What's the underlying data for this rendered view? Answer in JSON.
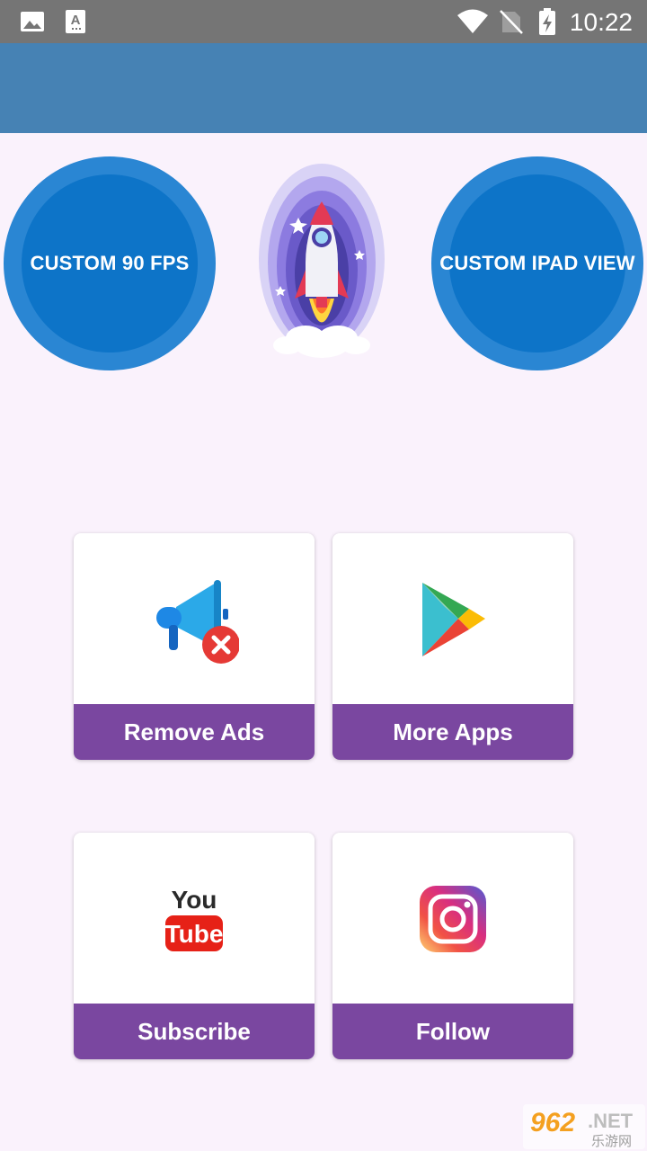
{
  "status_bar": {
    "time": "10:22",
    "icons": [
      "image-icon",
      "font-icon",
      "wifi-icon",
      "no-sim-icon",
      "battery-charging-icon"
    ]
  },
  "main": {
    "left_button": {
      "label": "CUSTOM 90 FPS"
    },
    "right_button": {
      "label": "CUSTOM IPAD VIEW"
    },
    "center_image": "rocket-icon"
  },
  "cards": [
    {
      "label": "Remove Ads",
      "icon": "remove-ads-megaphone-icon"
    },
    {
      "label": "More Apps",
      "icon": "google-play-icon"
    },
    {
      "label": "Subscribe",
      "icon": "youtube-icon"
    },
    {
      "label": "Follow",
      "icon": "instagram-icon"
    }
  ],
  "watermark": {
    "brand": "962",
    "domain": ".NET",
    "sub": "乐游网"
  },
  "colors": {
    "app_bar": "#4682B4",
    "circle_outer": "#2A86D3",
    "circle_inner": "#0D74C8",
    "card_label": "#7A47A0",
    "background": "#FAF2FC"
  }
}
